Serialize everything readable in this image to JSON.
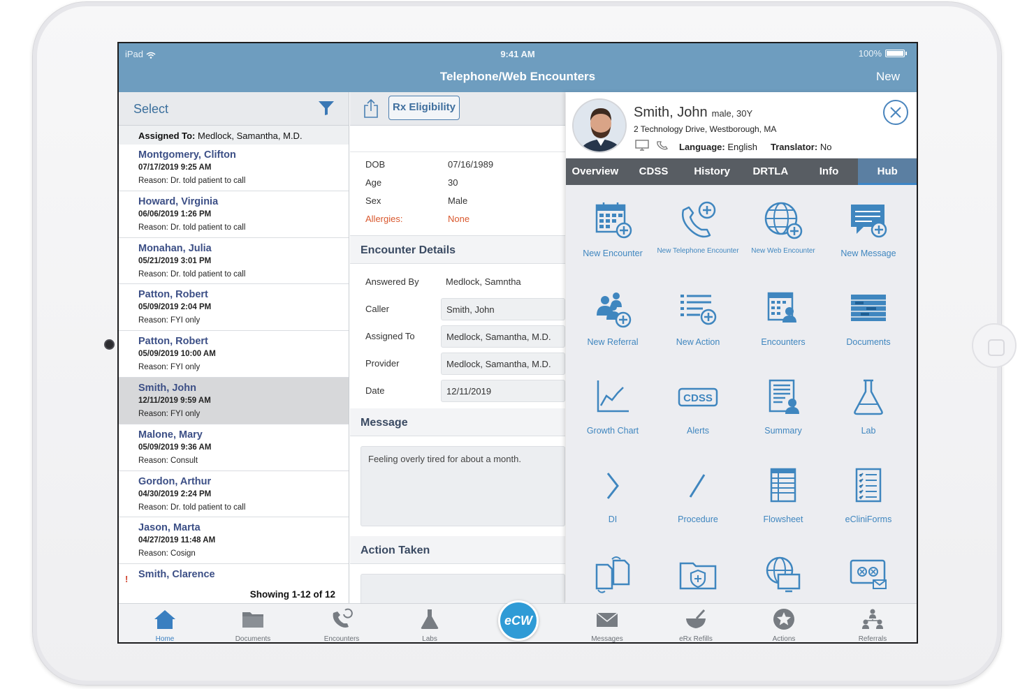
{
  "status": {
    "device": "iPad",
    "time": "9:41 AM",
    "battery": "100%"
  },
  "header": {
    "title": "Telephone/Web Encounters",
    "new_label": "New"
  },
  "left": {
    "select_label": "Select",
    "assigned_label": "Assigned To:",
    "assigned_value": "Medlock, Samantha, M.D.",
    "items": [
      {
        "name": "Montgomery, Clifton",
        "date": "07/17/2019 9:25 AM",
        "reason": "Reason: Dr. told patient to call"
      },
      {
        "name": "Howard, Virginia",
        "date": "06/06/2019 1:26 PM",
        "reason": "Reason: Dr. told patient to call"
      },
      {
        "name": "Monahan, Julia",
        "date": "05/21/2019 3:01 PM",
        "reason": "Reason: Dr. told patient to call"
      },
      {
        "name": "Patton, Robert",
        "date": "05/09/2019 2:04 PM",
        "reason": "Reason: FYI only"
      },
      {
        "name": "Patton, Robert",
        "date": "05/09/2019 10:00 AM",
        "reason": "Reason: FYI only"
      },
      {
        "name": "Smith, John",
        "date": "12/11/2019 9:59 AM",
        "reason": "Reason: FYI only"
      },
      {
        "name": "Malone, Mary",
        "date": "05/09/2019 9:36 AM",
        "reason": "Reason: Consult"
      },
      {
        "name": "Gordon, Arthur",
        "date": "04/30/2019 2:24 PM",
        "reason": "Reason: Dr. told patient to call"
      },
      {
        "name": "Jason, Marta",
        "date": "04/27/2019 11:48 AM",
        "reason": "Reason: Cosign"
      },
      {
        "name": "Smith, Clarence",
        "date": "",
        "reason": ""
      }
    ],
    "showing": "Showing 1-12 of 12"
  },
  "middle": {
    "rx_label": "Rx Eligibility",
    "demographics": {
      "dob_label": "DOB",
      "dob": "07/16/1989",
      "age_label": "Age",
      "age": "30",
      "sex_label": "Sex",
      "sex": "Male",
      "allergies_label": "Allergies:",
      "allergies": "None"
    },
    "encounter_details_title": "Encounter Details",
    "details": {
      "answered_by_label": "Answered By",
      "answered_by": "Medlock, Samntha",
      "caller_label": "Caller",
      "caller": "Smith, John",
      "assigned_to_label": "Assigned To",
      "assigned_to": "Medlock, Samantha, M.D.",
      "provider_label": "Provider",
      "provider": "Medlock, Samantha, M.D.",
      "date_label": "Date",
      "date": "12/11/2019"
    },
    "message_title": "Message",
    "message": "Feeling overly tired for about a month.",
    "action_taken_title": "Action Taken"
  },
  "patient": {
    "name": "Smith, John",
    "meta": "male, 30Y",
    "address": "2 Technology Drive, Westborough, MA",
    "language_label": "Language:",
    "language": "English",
    "translator_label": "Translator:",
    "translator": "No"
  },
  "hub": {
    "tabs": [
      "Overview",
      "CDSS",
      "History",
      "DRTLA",
      "Info",
      "Hub"
    ],
    "active_tab": "Hub",
    "accent_color": "#3f86bf",
    "items": [
      {
        "label": "New Encounter",
        "icon": "calendar-plus-icon"
      },
      {
        "label": "New Telephone Encounter",
        "icon": "phone-plus-icon"
      },
      {
        "label": "New Web Encounter",
        "icon": "globe-plus-icon"
      },
      {
        "label": "New Message",
        "icon": "message-plus-icon"
      },
      {
        "label": "New Referral",
        "icon": "referral-plus-icon"
      },
      {
        "label": "New Action",
        "icon": "action-list-plus-icon"
      },
      {
        "label": "Encounters",
        "icon": "encounters-icon"
      },
      {
        "label": "Documents",
        "icon": "documents-icon"
      },
      {
        "label": "Growth Chart",
        "icon": "growth-chart-icon"
      },
      {
        "label": "Alerts",
        "icon": "cdss-alerts-icon",
        "badge": "CDSS"
      },
      {
        "label": "Summary",
        "icon": "summary-icon"
      },
      {
        "label": "Lab",
        "icon": "flask-icon"
      },
      {
        "label": "DI",
        "icon": "chevron-right-icon"
      },
      {
        "label": "Procedure",
        "icon": "slash-icon"
      },
      {
        "label": "Flowsheet",
        "icon": "flowsheet-icon"
      },
      {
        "label": "eCliniForms",
        "icon": "checklist-icon"
      },
      {
        "label": "",
        "icon": "copy-documents-icon"
      },
      {
        "label": "",
        "icon": "folder-shield-icon"
      },
      {
        "label": "",
        "icon": "globe-monitor-icon"
      },
      {
        "label": "",
        "icon": "video-message-icon"
      }
    ]
  },
  "tabbar": {
    "items": [
      {
        "label": "Home",
        "icon": "home-icon"
      },
      {
        "label": "Documents",
        "icon": "folder-icon"
      },
      {
        "label": "Encounters",
        "icon": "phone-sync-icon"
      },
      {
        "label": "Labs",
        "icon": "flask-icon"
      },
      {
        "label": "eCW",
        "icon": "ecw-logo-icon"
      },
      {
        "label": "Messages",
        "icon": "envelope-icon"
      },
      {
        "label": "eRx Refills",
        "icon": "mortar-pestle-icon"
      },
      {
        "label": "Actions",
        "icon": "star-icon"
      },
      {
        "label": "Referrals",
        "icon": "referrals-icon"
      }
    ],
    "active": "Home"
  }
}
